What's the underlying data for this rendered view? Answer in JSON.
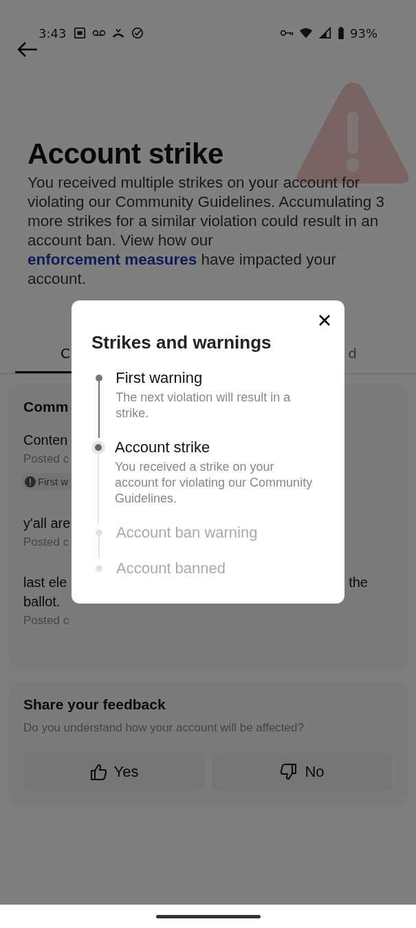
{
  "status_bar": {
    "time": "3:43",
    "battery": "93%"
  },
  "header": {
    "title": "Account strike",
    "description": "You received multiple strikes on your account for violating our Community Guidelines. Accumulating 3 more strikes for a similar violation could result in an account ban. View how our ",
    "link": "enforcement measures",
    "description_end": " have impacted your account."
  },
  "tabs": [
    {
      "label": "C",
      "selected": true
    },
    {
      "label": "d",
      "selected": false
    }
  ],
  "card": {
    "title": "Comm",
    "posts": [
      {
        "text": "Conten",
        "meta": "Posted c",
        "badge": "First w"
      },
      {
        "text": "y'all are",
        "meta": "Posted c"
      },
      {
        "text": "last ele",
        "text_right": "the",
        "text_line2": "ballot.",
        "meta": "Posted c"
      }
    ]
  },
  "feedback": {
    "title": "Share your feedback",
    "question": "Do you understand how your account will be affected?",
    "buttons": [
      {
        "kind": "yes",
        "label": "Yes"
      },
      {
        "kind": "no",
        "label": "No"
      }
    ]
  },
  "dialog": {
    "title": "Strikes and warnings",
    "steps": [
      {
        "title": "First warning",
        "description": "The next violation will result in a strike.",
        "selected": false,
        "disabled": false
      },
      {
        "title": "Account strike",
        "description": "You received a strike on your account for violating our Community Guidelines.",
        "selected": true,
        "disabled": false
      },
      {
        "title": "Account ban warning",
        "selected": false,
        "disabled": true
      },
      {
        "title": "Account banned",
        "selected": false,
        "disabled": true
      }
    ]
  }
}
